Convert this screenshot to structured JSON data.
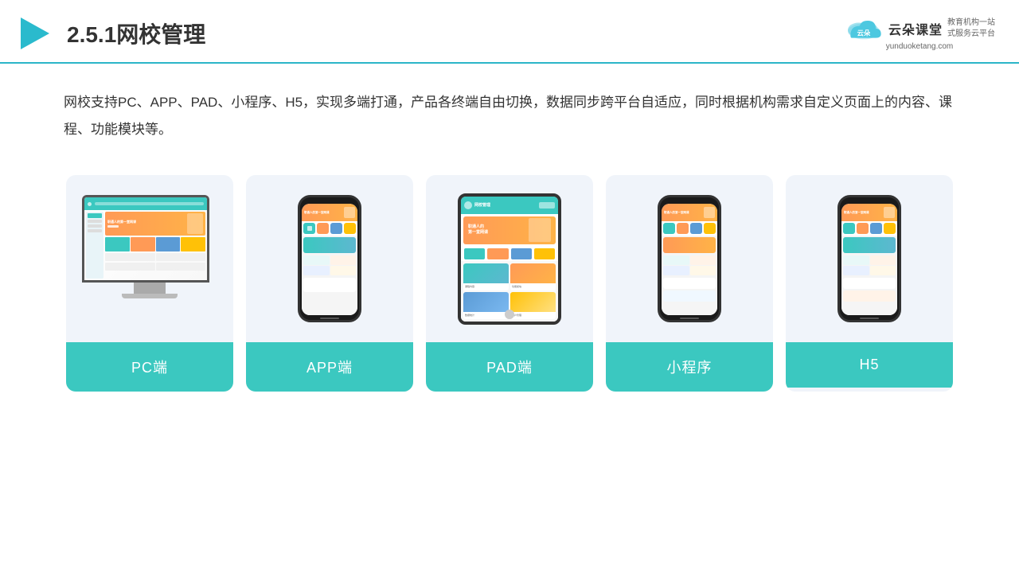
{
  "header": {
    "title": "2.5.1网校管理",
    "logo_main": "云朵课堂",
    "logo_url": "yunduoketang.com",
    "logo_tagline": "教育机构一站\n式服务云平台"
  },
  "description": {
    "text": "网校支持PC、APP、PAD、小程序、H5，实现多端打通，产品各终端自由切换，数据同步跨平台自适应，同时根据机构需求自定义页面上的内容、课程、功能模块等。"
  },
  "cards": [
    {
      "label": "PC端",
      "type": "pc"
    },
    {
      "label": "APP端",
      "type": "phone"
    },
    {
      "label": "PAD端",
      "type": "tablet"
    },
    {
      "label": "小程序",
      "type": "phone2"
    },
    {
      "label": "H5",
      "type": "phone3"
    }
  ],
  "colors": {
    "accent": "#3bc8c0",
    "border": "#2bb5c8",
    "card_bg": "#f0f4fa",
    "text_dark": "#333333"
  }
}
